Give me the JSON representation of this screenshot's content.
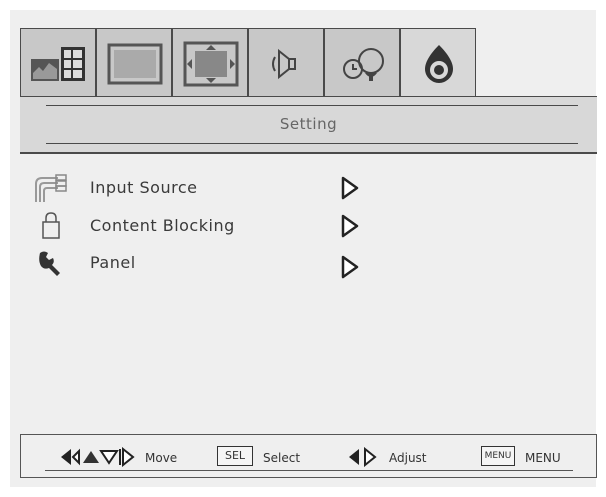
{
  "tabs": [
    {
      "icon": "picture-in-picture-icon"
    },
    {
      "icon": "screen-icon"
    },
    {
      "icon": "aspect-ratio-icon"
    },
    {
      "icon": "audio-speaker-icon"
    },
    {
      "icon": "time-clock-icon"
    },
    {
      "icon": "setting-icon",
      "active": true
    }
  ],
  "header": {
    "title": "Setting"
  },
  "menu": {
    "items": [
      {
        "label": "Input Source",
        "icon": "input-cables-icon"
      },
      {
        "label": "Content Blocking",
        "icon": "lock-icon"
      },
      {
        "label": "Panel",
        "icon": "wrench-icon"
      }
    ]
  },
  "footer": {
    "move_label": "Move",
    "sel_key": "SEL",
    "select_label": "Select",
    "adjust_label": "Adjust",
    "menu_key": "MENU",
    "menu_label": "MENU"
  },
  "colors": {
    "panel": "#efefef",
    "tab": "#c8c8c8",
    "active_tab": "#d8d8d8",
    "border": "#4a4a4a"
  }
}
